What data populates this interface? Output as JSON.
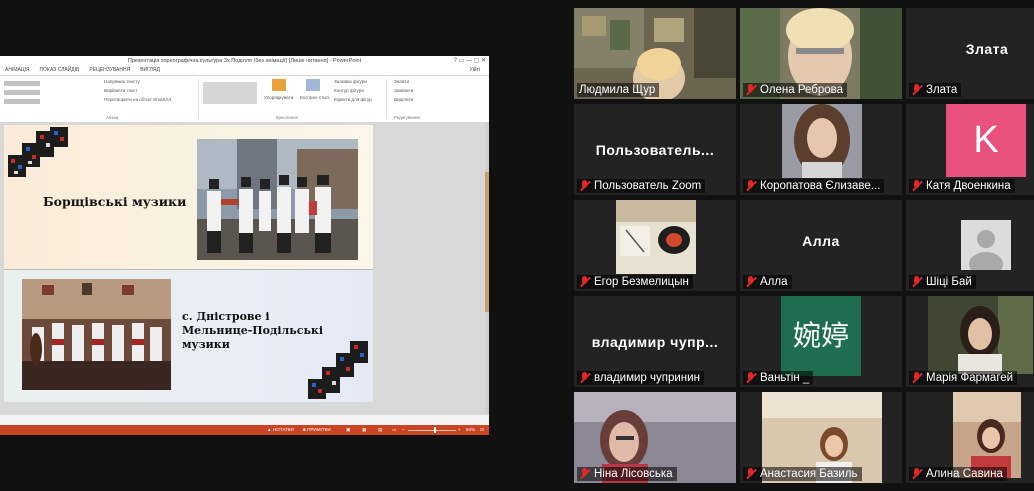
{
  "powerpoint": {
    "window_title": "Презентація хореографічна культура Зх.Поділля (без анімації) [Лише читання] - PowerPoint",
    "window_controls": "?  ▭  —  ▢  ✕",
    "tabs": [
      "АНІМАЦІЯ",
      "ПОКАЗ СЛАЙДІВ",
      "РЕЦЕНЗУВАННЯ",
      "ВИГЛЯД"
    ],
    "user": "Уійті",
    "ribbon": {
      "text_direction": "Напрямок тексту",
      "align_text": "Вирівняти текст",
      "smartart": "Перетворити на об'єкт SmartArt",
      "paragraph": "Абзац",
      "arrange": "Упорядкувати",
      "quick_styles": "Експрес-стилі",
      "fill": "Заливка фігури",
      "outline": "Контур фігури",
      "effects": "Ефекти для фігур",
      "drawing": "Креслення",
      "find": "Знайти",
      "replace": "Замінити",
      "select": "Виділити",
      "editing": "Редагування"
    },
    "slide": {
      "heading_top": "Борщівські музики",
      "heading_bottom": "с. Дністрове і Мельнице-Подільські музики"
    },
    "status": {
      "notes": "НОТАТКИ",
      "comments": "ПРИМІТКИ",
      "zoom": "64%",
      "zoom_level": 0.55
    }
  },
  "participants": [
    {
      "name": "Людмила Щур",
      "muted": false,
      "active": true,
      "display": "video"
    },
    {
      "name": "Олена Реброва",
      "muted": true,
      "active": false,
      "display": "video"
    },
    {
      "name": "Злата",
      "muted": true,
      "active": false,
      "display": "name",
      "big_name": "Злата"
    },
    {
      "name": "Пользователь Zoom",
      "muted": true,
      "active": false,
      "display": "name",
      "big_name": "Пользователь..."
    },
    {
      "name": "Коропатова Єлизаве...",
      "muted": true,
      "active": false,
      "display": "video"
    },
    {
      "name": "Катя Двоенкина",
      "muted": true,
      "active": false,
      "display": "avatar",
      "avatar_letter": "K",
      "avatar_color": "#e8517c"
    },
    {
      "name": "Егор Безмелицын",
      "muted": true,
      "active": false,
      "display": "video"
    },
    {
      "name": "Алла",
      "muted": true,
      "active": false,
      "display": "name",
      "big_name": "Алла"
    },
    {
      "name": "Шіці Бай",
      "muted": true,
      "active": false,
      "display": "avatar-gray"
    },
    {
      "name": "владимир чупринин",
      "muted": true,
      "active": false,
      "display": "name",
      "big_name": "владимир  чупр..."
    },
    {
      "name": "Ваньтін _",
      "muted": true,
      "active": false,
      "display": "avatar-cjk",
      "avatar_text": "婉婷"
    },
    {
      "name": "Марія Фармагей",
      "muted": true,
      "active": false,
      "display": "video"
    },
    {
      "name": "Ніна Лісовська",
      "muted": true,
      "active": false,
      "display": "video"
    },
    {
      "name": "Анастасия Базиль",
      "muted": true,
      "active": false,
      "display": "video"
    },
    {
      "name": "Алина Савина",
      "muted": true,
      "active": false,
      "display": "video"
    }
  ],
  "colors": {
    "active_speaker_border": "#e9e95f",
    "muted_icon": "#e02828",
    "ppt_status_bar": "#c94525"
  }
}
